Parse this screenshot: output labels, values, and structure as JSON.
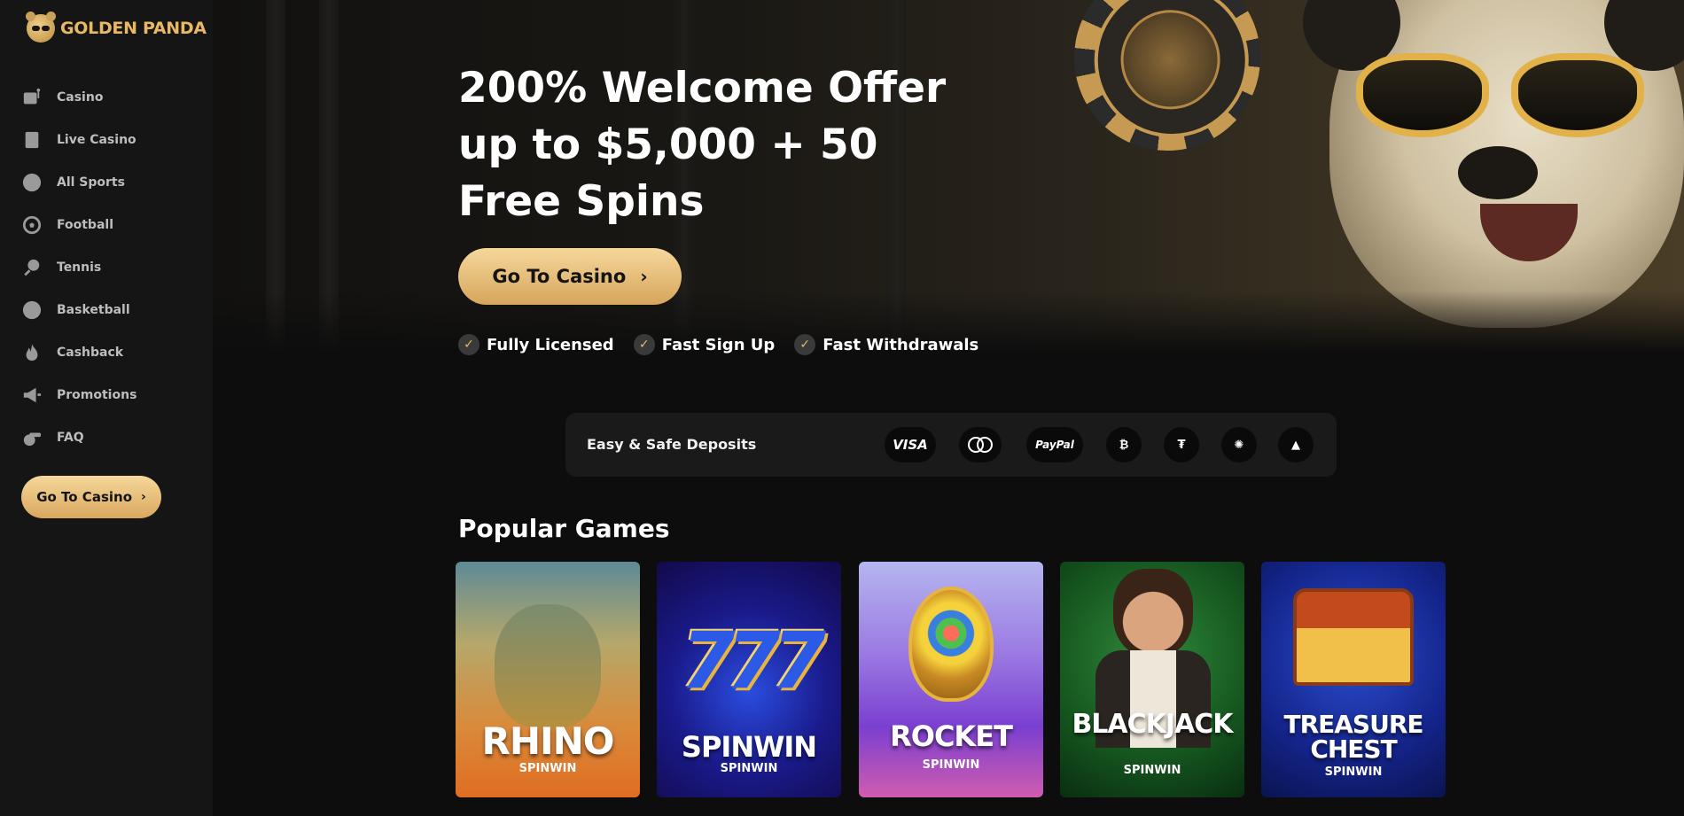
{
  "brand": {
    "name": "GOLDEN PANDA"
  },
  "sidebar": {
    "items": [
      {
        "label": "Casino",
        "icon": "slot-machine-icon"
      },
      {
        "label": "Live Casino",
        "icon": "playing-card-icon"
      },
      {
        "label": "All Sports",
        "icon": "star-badge-icon"
      },
      {
        "label": "Football",
        "icon": "football-icon"
      },
      {
        "label": "Tennis",
        "icon": "tennis-racket-icon"
      },
      {
        "label": "Basketball",
        "icon": "basketball-icon"
      },
      {
        "label": "Cashback",
        "icon": "flame-icon"
      },
      {
        "label": "Promotions",
        "icon": "megaphone-icon"
      },
      {
        "label": "FAQ",
        "icon": "whistle-icon"
      }
    ],
    "cta_label": "Go To Casino"
  },
  "hero": {
    "title_lines": [
      "200% Welcome Offer",
      "up to $5,000 + 50",
      "Free Spins"
    ],
    "cta_label": "Go To Casino",
    "features": [
      "Fully Licensed",
      "Fast Sign Up",
      "Fast Withdrawals"
    ]
  },
  "deposits": {
    "label": "Easy & Safe Deposits",
    "methods": [
      {
        "name": "VISA",
        "icon": "visa-icon"
      },
      {
        "name": "mastercard",
        "icon": "mastercard-icon"
      },
      {
        "name": "PayPal",
        "icon": "paypal-icon"
      },
      {
        "name": "Bitcoin",
        "icon": "bitcoin-icon"
      },
      {
        "name": "Tether",
        "icon": "tether-icon"
      },
      {
        "name": "Cardano",
        "icon": "cardano-icon"
      },
      {
        "name": "Avalanche",
        "icon": "avalanche-icon"
      }
    ]
  },
  "popular": {
    "title": "Popular Games",
    "games": [
      {
        "title": "RHINO",
        "provider": "SPINWIN"
      },
      {
        "title": "SPINWIN",
        "provider": "SPINWIN"
      },
      {
        "title": "ROCKET",
        "provider": "SPINWIN"
      },
      {
        "title": "BLACKJACK",
        "provider": "SPINWIN"
      },
      {
        "title_line1": "TREASURE",
        "title_line2": "CHEST",
        "provider": "SPINWIN"
      }
    ]
  },
  "colors": {
    "accent": "#e8b865",
    "sidebar_bg": "#151515",
    "page_bg": "#0d0d0d"
  }
}
